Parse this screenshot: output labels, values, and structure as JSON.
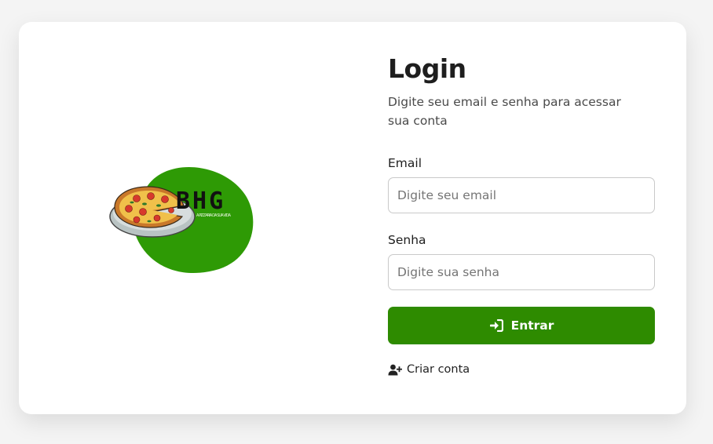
{
  "logo": {
    "brand": "BHG",
    "tagline": "A PIZZARIA DA SUA VIDA",
    "icon": "pizza-logo",
    "blob_color": "#2e9a05"
  },
  "login": {
    "title": "Login",
    "subtitle": "Digite seu email e senha para acessar sua conta",
    "email_label": "Email",
    "email_placeholder": "Digite seu email",
    "email_value": "",
    "password_label": "Senha",
    "password_placeholder": "Digite sua senha",
    "password_value": "",
    "submit_label": "Entrar",
    "submit_icon": "sign-in-icon",
    "create_account_label": "Criar conta",
    "create_account_icon": "user-plus-icon"
  },
  "colors": {
    "accent": "#2e8b00",
    "background": "#f4f4f4",
    "card": "#ffffff"
  }
}
